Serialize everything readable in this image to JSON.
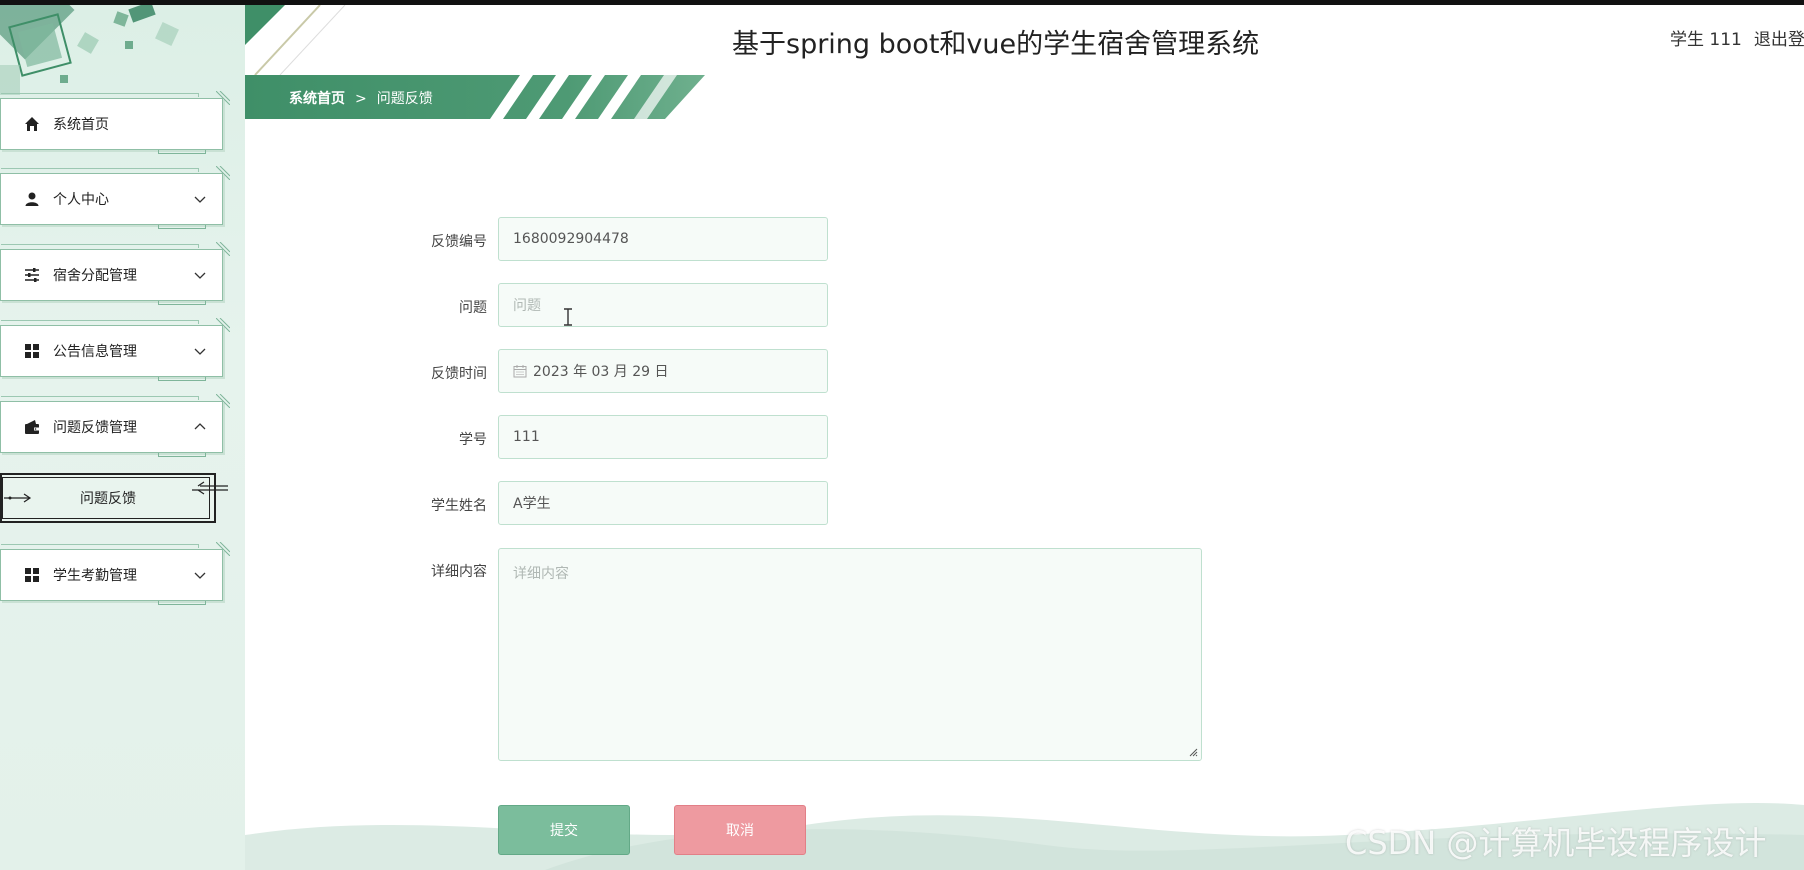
{
  "app": {
    "title": "基于spring boot和vue的学生宿舍管理系统",
    "user_label": "学生 111",
    "logout_label": "退出登"
  },
  "breadcrumb": {
    "home": "系统首页",
    "separator": ">",
    "current": "问题反馈"
  },
  "sidebar": {
    "items": [
      {
        "label": "系统首页",
        "icon": "home-icon"
      },
      {
        "label": "个人中心",
        "icon": "user-icon"
      },
      {
        "label": "宿舍分配管理",
        "icon": "sliders-icon"
      },
      {
        "label": "公告信息管理",
        "icon": "grid-icon"
      },
      {
        "label": "问题反馈管理",
        "icon": "wallet-icon"
      },
      {
        "label": "学生考勤管理",
        "icon": "grid-icon"
      }
    ],
    "submenu_active": "问题反馈"
  },
  "form": {
    "feedback_no": {
      "label": "反馈编号",
      "value": "1680092904478"
    },
    "question": {
      "label": "问题",
      "placeholder": "问题"
    },
    "feedback_time": {
      "label": "反馈时间",
      "value": "2023 年 03 月 29 日"
    },
    "student_no": {
      "label": "学号",
      "value": "111"
    },
    "student_name": {
      "label": "学生姓名",
      "value": "A学生"
    },
    "detail": {
      "label": "详细内容",
      "placeholder": "详细内容"
    },
    "submit_label": "提交",
    "cancel_label": "取消"
  },
  "watermark": "CSDN @计算机毕设程序设计",
  "colors": {
    "accent": "#3f8f68",
    "sidebar_bg": "#e3f1ea",
    "submit": "#7bbd9c",
    "cancel": "#ee9aa0"
  }
}
